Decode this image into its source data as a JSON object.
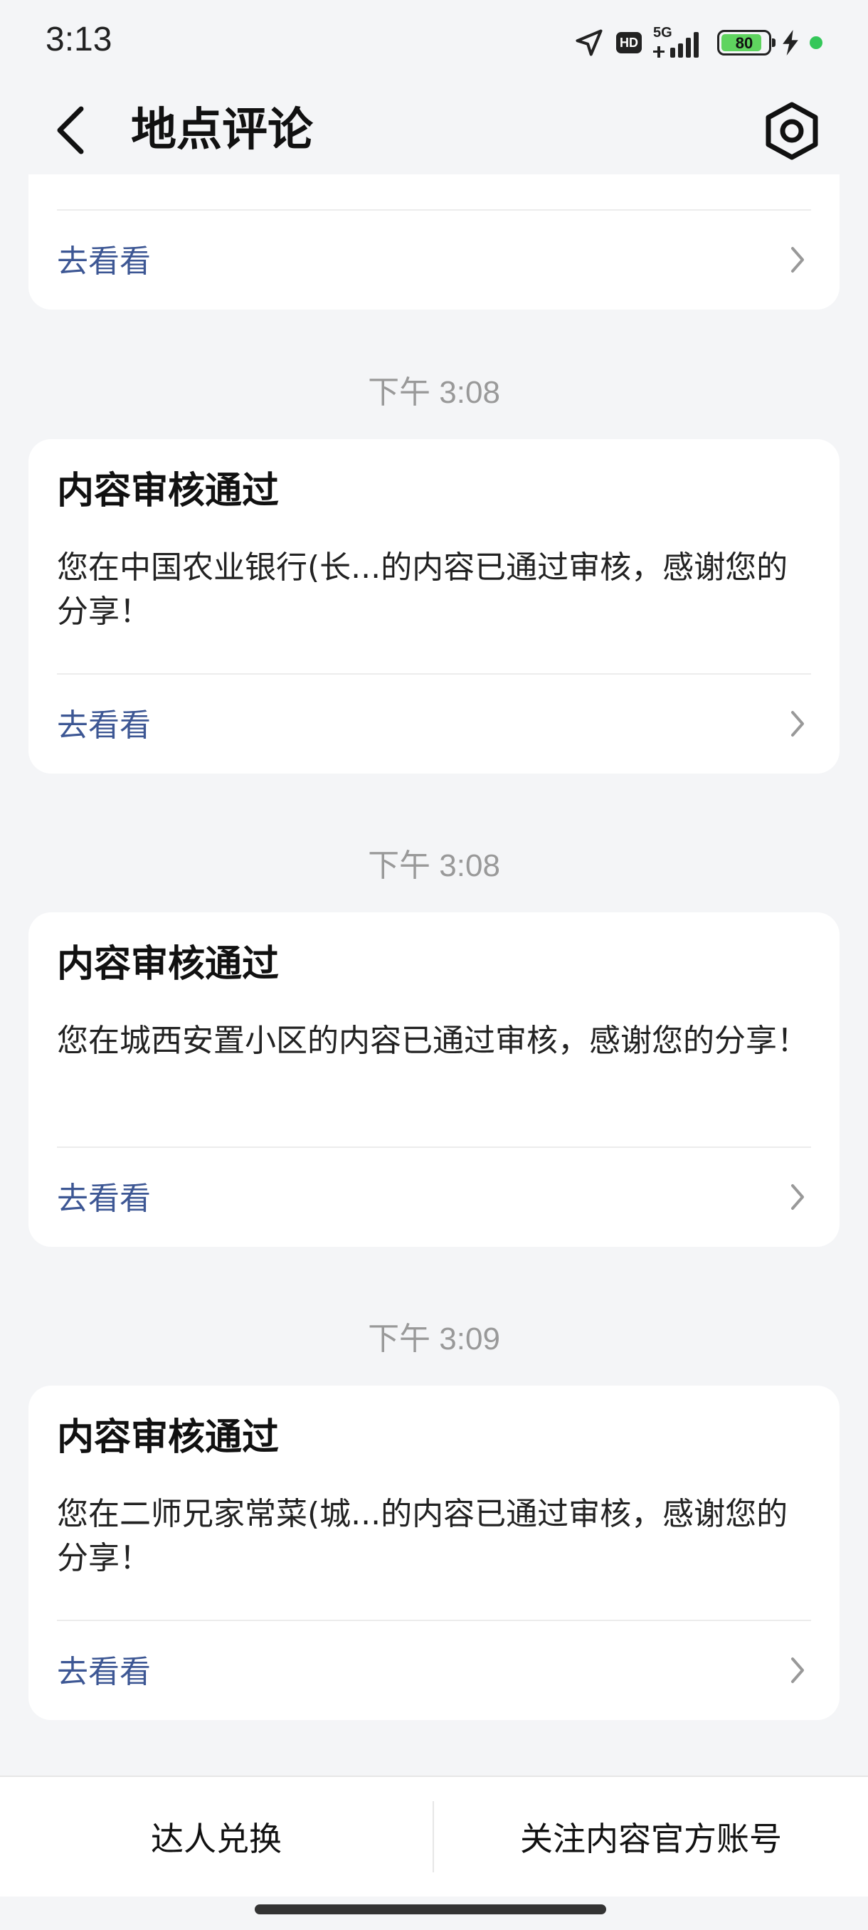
{
  "status_bar": {
    "time": "3:13",
    "hd": "HD",
    "network": "5G",
    "battery": "80",
    "icons": [
      "location-arrow-icon",
      "hd-icon",
      "signal-5g-icon",
      "battery-icon",
      "charging-bolt-icon",
      "green-dot-icon"
    ]
  },
  "header": {
    "back_icon": "chevron-left-icon",
    "title": "地点评论",
    "settings_icon": "hex-settings-icon"
  },
  "partial_card": {
    "link_label": "去看看"
  },
  "messages": [
    {
      "timestamp": "下午 3:08",
      "title": "内容审核通过",
      "body": "您在中国农业银行(长...的内容已通过审核，感谢您的分享！",
      "link_label": "去看看"
    },
    {
      "timestamp": "下午 3:08",
      "title": "内容审核通过",
      "body": "您在城西安置小区的内容已通过审核，感谢您的分享！",
      "link_label": "去看看"
    },
    {
      "timestamp": "下午 3:09",
      "title": "内容审核通过",
      "body": "您在二师兄家常菜(城...的内容已通过审核，感谢您的分享！",
      "link_label": "去看看"
    }
  ],
  "bottom_bar": {
    "left_label": "达人兑换",
    "right_label": "关注内容官方账号"
  },
  "colors": {
    "background": "#f4f5f7",
    "card": "#ffffff",
    "link": "#3d5794",
    "timestamp": "#999999"
  }
}
